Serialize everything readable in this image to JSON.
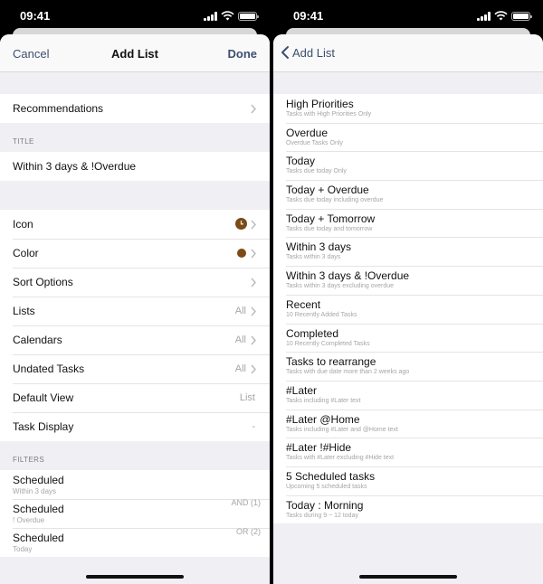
{
  "status": {
    "time": "09:41"
  },
  "left": {
    "nav": {
      "cancel": "Cancel",
      "title": "Add List",
      "done": "Done"
    },
    "recommendations": "Recommendations",
    "title_header": "TITLE",
    "title_value": "Within 3 days & !Overdue",
    "settings": [
      {
        "label": "Icon",
        "value": "",
        "accessory": "clock-icon"
      },
      {
        "label": "Color",
        "value": "",
        "accessory": "color-dot"
      },
      {
        "label": "Sort Options",
        "value": ""
      },
      {
        "label": "Lists",
        "value": "All"
      },
      {
        "label": "Calendars",
        "value": "All"
      },
      {
        "label": "Undated Tasks",
        "value": "All"
      },
      {
        "label": "Default View",
        "value": "List"
      },
      {
        "label": "Task Display",
        "value": "-"
      }
    ],
    "filters_header": "FILTERS",
    "filters": [
      {
        "title": "Scheduled",
        "subtitle": "Within 3 days",
        "op": ""
      },
      {
        "title": "Scheduled",
        "subtitle": "! Overdue",
        "op": "AND (1)"
      },
      {
        "title": "Scheduled",
        "subtitle": "Today",
        "op": "OR (2)"
      }
    ],
    "accent_color": "#7a4a17"
  },
  "right": {
    "nav": {
      "back": "Add List"
    },
    "items": [
      {
        "title": "High Priorities",
        "subtitle": "Tasks with High Priorities Only"
      },
      {
        "title": "Overdue",
        "subtitle": "Overdue Tasks Only"
      },
      {
        "title": "Today",
        "subtitle": "Tasks due today Only"
      },
      {
        "title": "Today + Overdue",
        "subtitle": "Tasks due today including overdue"
      },
      {
        "title": "Today + Tomorrow",
        "subtitle": "Tasks due today and tomorrow"
      },
      {
        "title": "Within 3 days",
        "subtitle": "Tasks within 3 days"
      },
      {
        "title": "Within 3 days & !Overdue",
        "subtitle": "Tasks within 3 days excluding overdue"
      },
      {
        "title": "Recent",
        "subtitle": "10 Recently Added Tasks"
      },
      {
        "title": "Completed",
        "subtitle": "10 Recently Completed Tasks"
      },
      {
        "title": "Tasks to rearrange",
        "subtitle": "Tasks with due date more than 2 weeks ago"
      },
      {
        "title": "#Later",
        "subtitle": "Tasks including #Later text"
      },
      {
        "title": "#Later @Home",
        "subtitle": "Tasks including #Later and @Home text"
      },
      {
        "title": "#Later !#Hide",
        "subtitle": "Tasks with #Later excluding #Hide text"
      },
      {
        "title": "5 Scheduled tasks",
        "subtitle": "Upcoming 5 scheduled tasks"
      },
      {
        "title": "Today : Morning",
        "subtitle": "Tasks during 9 ~ 12 today"
      }
    ]
  }
}
